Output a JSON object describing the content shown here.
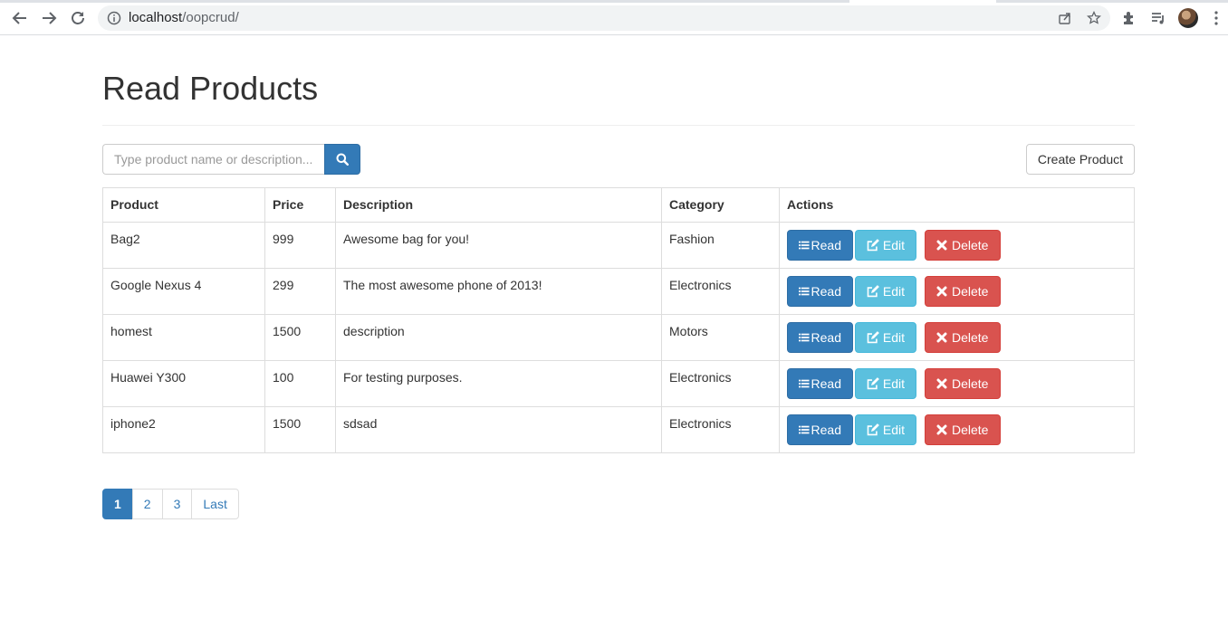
{
  "browser": {
    "url_host": "localhost",
    "url_path": "/oopcrud/"
  },
  "page": {
    "title": "Read Products"
  },
  "search": {
    "placeholder": "Type product name or description...",
    "value": ""
  },
  "toolbar": {
    "create_label": "Create Product"
  },
  "table": {
    "headers": [
      "Product",
      "Price",
      "Description",
      "Category",
      "Actions"
    ],
    "rows": [
      {
        "product": "Bag2",
        "price": "999",
        "description": "Awesome bag for you!",
        "category": "Fashion"
      },
      {
        "product": "Google Nexus 4",
        "price": "299",
        "description": "The most awesome phone of 2013!",
        "category": "Electronics"
      },
      {
        "product": "homest",
        "price": "1500",
        "description": "description",
        "category": "Motors"
      },
      {
        "product": "Huawei Y300",
        "price": "100",
        "description": "For testing purposes.",
        "category": "Electronics"
      },
      {
        "product": "iphone2",
        "price": "1500",
        "description": "sdsad",
        "category": "Electronics"
      }
    ],
    "actions": {
      "read_label": "Read",
      "edit_label": "Edit",
      "delete_label": "Delete"
    }
  },
  "pagination": {
    "pages": [
      "1",
      "2",
      "3",
      "Last"
    ],
    "active": "1"
  },
  "colors": {
    "primary": "#337ab7",
    "info": "#5bc0de",
    "danger": "#d9534f",
    "border": "#dddddd"
  },
  "icons": {
    "back": "arrow-left-icon",
    "forward": "arrow-right-icon",
    "reload": "reload-icon",
    "site_info": "info-icon",
    "share": "share-icon",
    "bookmark": "star-icon",
    "extensions": "puzzle-icon",
    "reading_list": "reading-list-icon",
    "menu": "kebab-menu-icon",
    "search": "search-icon",
    "read": "list-icon",
    "edit": "edit-icon",
    "delete": "times-icon"
  }
}
